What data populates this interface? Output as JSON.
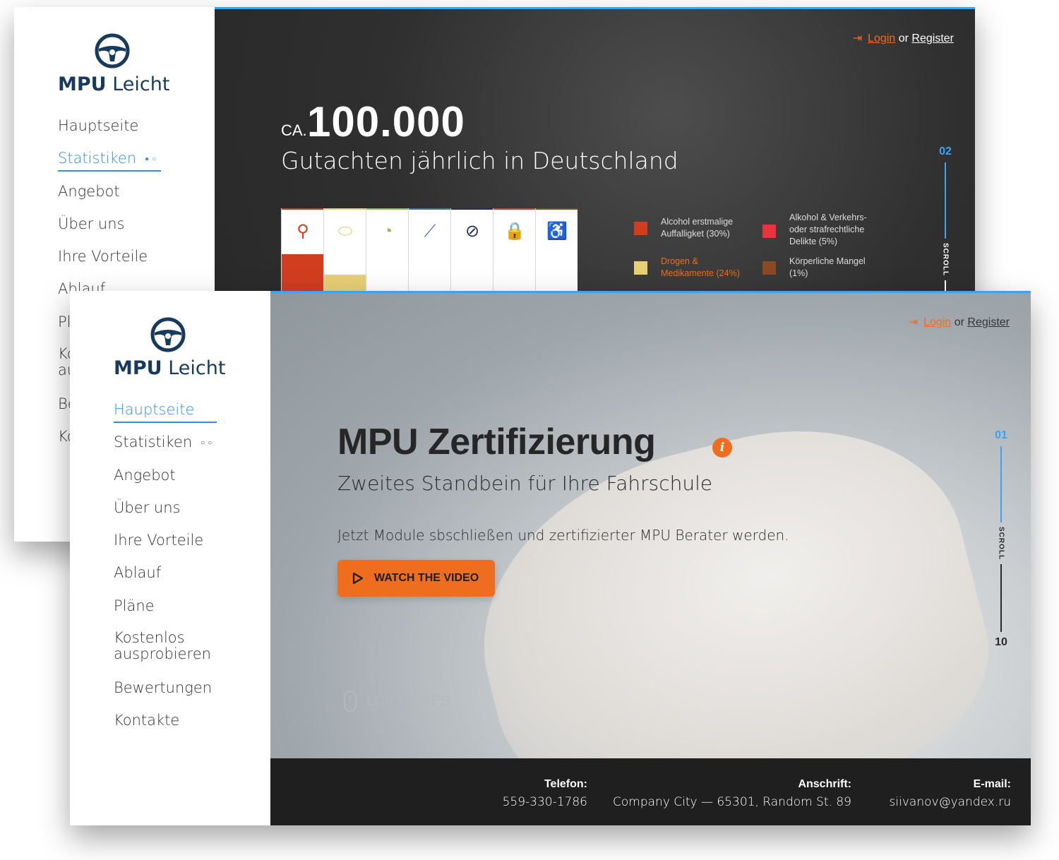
{
  "brand": {
    "name_bold": "MPU",
    "name_light": "Leicht"
  },
  "colors": {
    "accent": "#ef6d1f",
    "link_blue": "#2f8fe8",
    "brand_navy": "#173a5e"
  },
  "auth": {
    "login": "Login",
    "or": "or",
    "register": "Register"
  },
  "nav": {
    "items": [
      {
        "label": "Hauptseite"
      },
      {
        "label": "Statistiken"
      },
      {
        "label": "Angebot"
      },
      {
        "label": "Über uns"
      },
      {
        "label": "Ihre Vorteile"
      },
      {
        "label": "Ablauf"
      },
      {
        "label": "Pläne"
      },
      {
        "label": "Kostenlos ausprobieren"
      },
      {
        "label": "Bewertungen"
      },
      {
        "label": "Kontakte"
      }
    ]
  },
  "stats_page": {
    "prefix": "CA.",
    "number": "100.000",
    "subtitle": "Gutachten jährlich in Deutschland",
    "categories": [
      {
        "icon": "bottle-icon",
        "color": "#d13d1f",
        "fill": 0.45
      },
      {
        "icon": "pills-icon",
        "color": "#e8cf75",
        "fill": 0.2
      },
      {
        "icon": "speedometer-icon",
        "color": "#8fbf4a",
        "fill": 0
      },
      {
        "icon": "syringe-icon",
        "color": "#4a6fb5",
        "fill": 0
      },
      {
        "icon": "prohibited-icon",
        "color": "#2a2a6a",
        "fill": 0
      },
      {
        "icon": "lock-icon",
        "color": "#e8353d",
        "fill": 0
      },
      {
        "icon": "wheelchair-icon",
        "color": "#8b4a22",
        "fill": 0
      }
    ],
    "legend": [
      {
        "text_1": "Alcohol erstmalige",
        "text_2": "Auffalligket (30%)",
        "text_3": "",
        "color": "#d13d1f",
        "text_color": "#dddddd"
      },
      {
        "text_1": "Alkohol & Verkehrs-",
        "text_2": "oder strafrechtliche",
        "text_3": "Delikte (5%)",
        "color": "#e8353d",
        "text_color": "#dddddd"
      },
      {
        "text_1": "Drogen &",
        "text_2": "Medikamente (24%)",
        "text_3": "",
        "color": "#e8cf75",
        "text_color": "#ef6d1f"
      },
      {
        "text_1": "Körperliche Mangel",
        "text_2": "(1%)",
        "text_3": "",
        "color": "#8b4a22",
        "text_color": "#dddddd"
      }
    ],
    "scroll": {
      "current": "02",
      "label": "SCROLL"
    }
  },
  "home_page": {
    "title": "MPU Zertifizierung",
    "info": "i",
    "subtitle": "Zweites Standbein für Ihre Fahrschule",
    "text": "Jetzt Module sbschließen und zertifizierter MPU Berater werden.",
    "cta": "WATCH THE VIDEO",
    "scroll_cta": "LOS GEHT'S",
    "scroll": {
      "current": "01",
      "label": "SCROLL",
      "total": "10"
    }
  },
  "footer": {
    "phone_label": "Telefon:",
    "phone": "559-330-1786",
    "address_label": "Anschrift:",
    "address": "Company City — 65301, Random St. 89",
    "email_label": "E-mail:",
    "email": "siivanov@yandex.ru"
  }
}
